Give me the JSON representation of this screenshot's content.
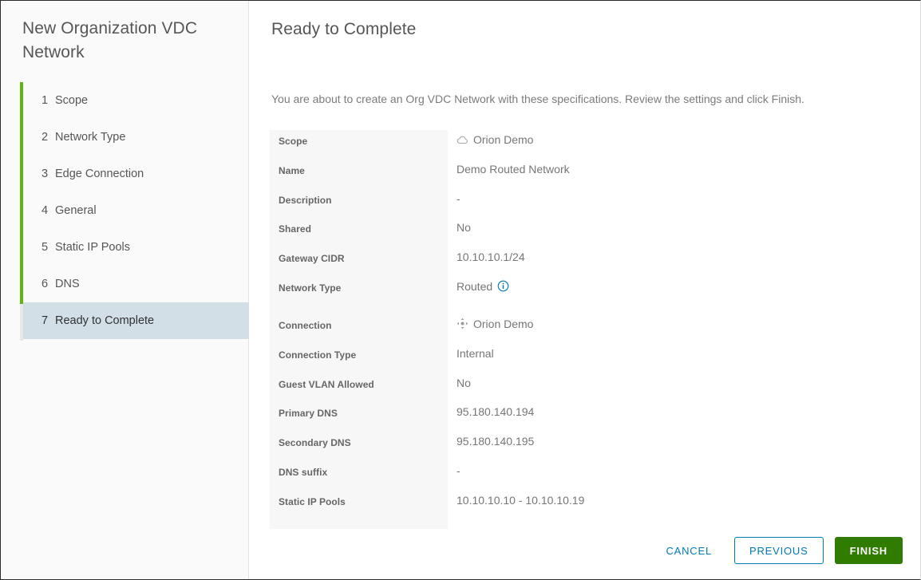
{
  "wizard": {
    "title": "New Organization VDC Network",
    "steps": [
      {
        "num": "1",
        "label": "Scope"
      },
      {
        "num": "2",
        "label": "Network Type"
      },
      {
        "num": "3",
        "label": "Edge Connection"
      },
      {
        "num": "4",
        "label": "General"
      },
      {
        "num": "5",
        "label": "Static IP Pools"
      },
      {
        "num": "6",
        "label": "DNS"
      },
      {
        "num": "7",
        "label": "Ready to Complete"
      }
    ],
    "active_index": 6,
    "progress_color": "#60b515",
    "active_background": "#d3dfe6"
  },
  "page": {
    "title": "Ready to Complete",
    "intro": "You are about to create an Org VDC Network with these specifications. Review the settings and click Finish."
  },
  "summary": [
    {
      "key": "Scope",
      "value": "Orion Demo",
      "icon": "cloud-icon"
    },
    {
      "key": "Name",
      "value": "Demo Routed Network"
    },
    {
      "key": "Description",
      "value": "-"
    },
    {
      "key": "Shared",
      "value": "No"
    },
    {
      "key": "Gateway CIDR",
      "value": "10.10.10.1/24"
    },
    {
      "key": "Network Type",
      "value": "Routed",
      "trailing_icon": "info-icon"
    },
    {
      "key": "Connection",
      "value": "Orion Demo",
      "icon": "network-connection-icon"
    },
    {
      "key": "Connection Type",
      "value": "Internal"
    },
    {
      "key": "Guest VLAN Allowed",
      "value": "No"
    },
    {
      "key": "Primary DNS",
      "value": "95.180.140.194"
    },
    {
      "key": "Secondary DNS",
      "value": "95.180.140.195"
    },
    {
      "key": "DNS suffix",
      "value": "-"
    },
    {
      "key": "Static IP Pools",
      "value": "10.10.10.10 - 10.10.10.19"
    }
  ],
  "footer": {
    "cancel_label": "Cancel",
    "previous_label": "Previous",
    "finish_label": "Finish",
    "link_color": "#0079b8",
    "finish_color": "#307c00"
  }
}
